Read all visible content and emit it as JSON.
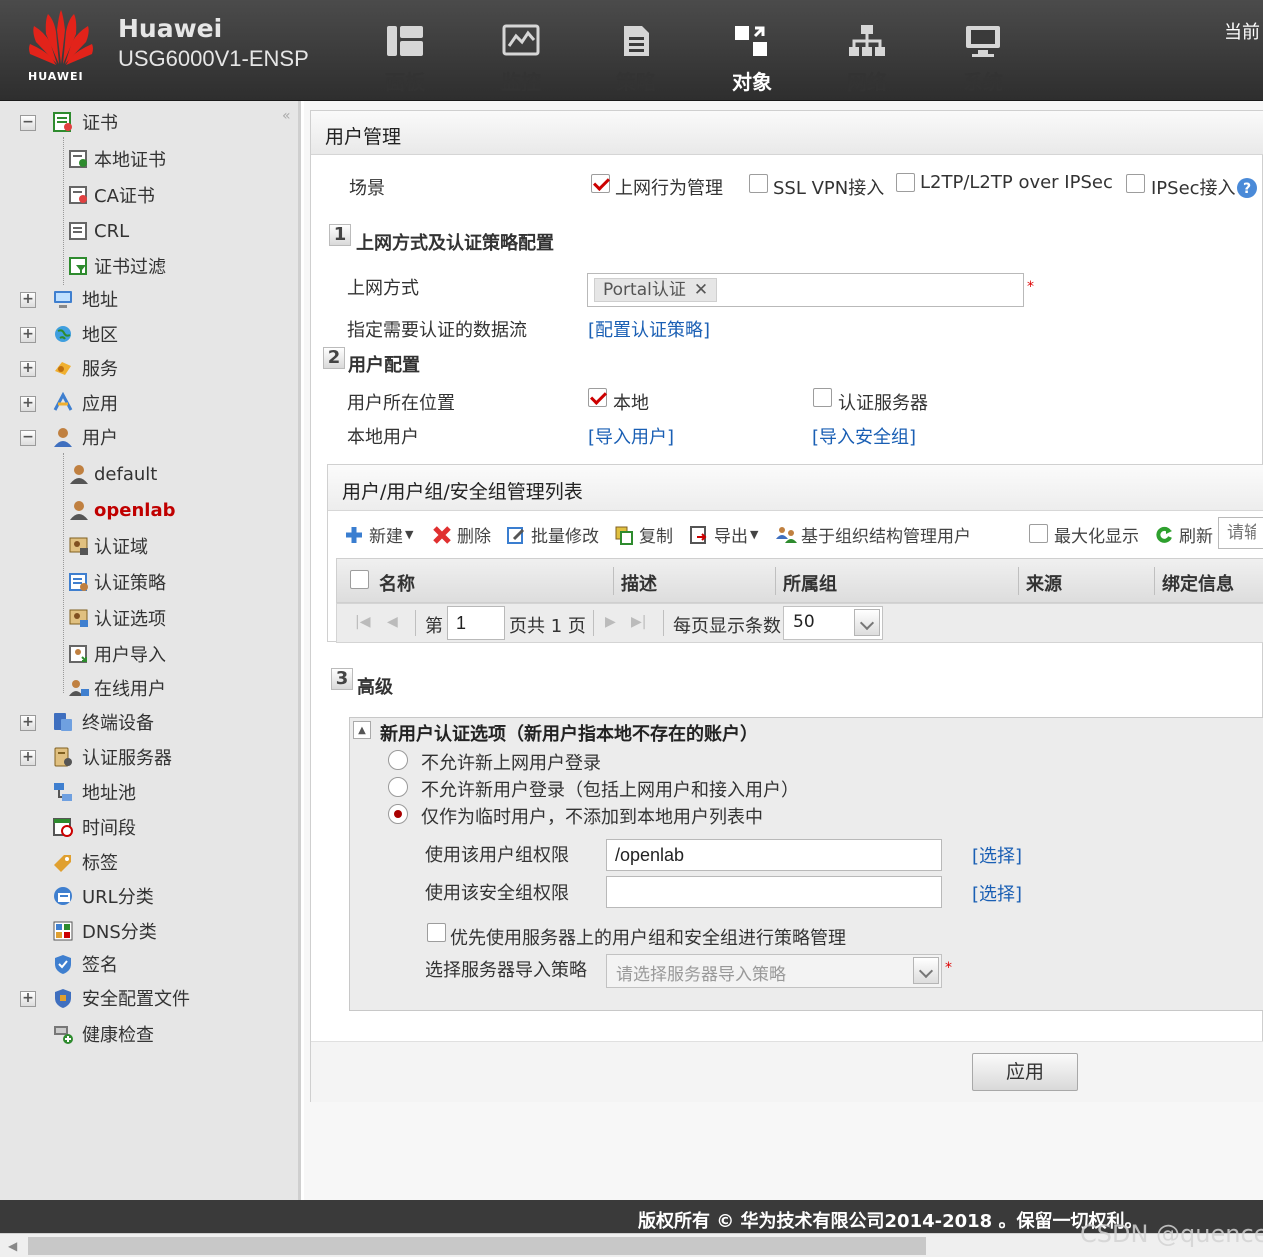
{
  "header": {
    "brand": "HUAWEI",
    "product_name": "Huawei",
    "product_model": "USG6000V1-ENSP",
    "current_user_label": "当前",
    "nav": [
      {
        "label": "面板",
        "icon": "dashboard-icon"
      },
      {
        "label": "监控",
        "icon": "monitor-icon"
      },
      {
        "label": "策略",
        "icon": "policy-icon"
      },
      {
        "label": "对象",
        "icon": "object-icon",
        "active": true
      },
      {
        "label": "网络",
        "icon": "network-icon"
      },
      {
        "label": "系统",
        "icon": "system-icon"
      }
    ]
  },
  "sidebar": {
    "items": [
      {
        "label": "证书",
        "expanded": true
      },
      {
        "label": "本地证书"
      },
      {
        "label": "CA证书"
      },
      {
        "label": "CRL"
      },
      {
        "label": "证书过滤"
      },
      {
        "label": "地址"
      },
      {
        "label": "地区"
      },
      {
        "label": "服务"
      },
      {
        "label": "应用"
      },
      {
        "label": "用户",
        "expanded": true
      },
      {
        "label": "default"
      },
      {
        "label": "openlab",
        "selected": true
      },
      {
        "label": "认证域"
      },
      {
        "label": "认证策略"
      },
      {
        "label": "认证选项"
      },
      {
        "label": "用户导入"
      },
      {
        "label": "在线用户"
      },
      {
        "label": "终端设备"
      },
      {
        "label": "认证服务器"
      },
      {
        "label": "地址池"
      },
      {
        "label": "时间段"
      },
      {
        "label": "标签"
      },
      {
        "label": "URL分类"
      },
      {
        "label": "DNS分类"
      },
      {
        "label": "签名"
      },
      {
        "label": "安全配置文件"
      },
      {
        "label": "健康检查"
      }
    ]
  },
  "main": {
    "title": "用户管理",
    "scene": {
      "label": "场景",
      "options": [
        {
          "label": "上网行为管理",
          "checked": true
        },
        {
          "label": "SSL VPN接入",
          "checked": false
        },
        {
          "label": "L2TP/L2TP over IPSec",
          "checked": false
        },
        {
          "label": "IPSec接入",
          "checked": false
        }
      ]
    },
    "section1": {
      "num": "1",
      "title": "上网方式及认证策略配置",
      "access_label": "上网方式",
      "access_tag": "Portal认证",
      "required_mark": "*",
      "flow_label": "指定需要认证的数据流",
      "flow_link": "[配置认证策略]"
    },
    "section2": {
      "num": "2",
      "title": "用户配置",
      "location_label": "用户所在位置",
      "location_local": {
        "label": "本地",
        "checked": true
      },
      "location_server": {
        "label": "认证服务器",
        "checked": false
      },
      "local_user_label": "本地用户",
      "import_user_link": "[导入用户]",
      "import_group_link": "[导入安全组]"
    },
    "grid": {
      "title": "用户/用户组/安全组管理列表",
      "toolbar": {
        "new": "新建",
        "delete": "删除",
        "batch_edit": "批量修改",
        "copy": "复制",
        "export": "导出",
        "org_manage": "基于组织结构管理用户",
        "maximize": "最大化显示",
        "refresh": "刷新",
        "search_placeholder": "请输"
      },
      "columns": [
        "名称",
        "描述",
        "所属组",
        "来源",
        "绑定信息"
      ],
      "pager": {
        "page_prefix": "第",
        "page_value": "1",
        "page_suffix": "页共 1 页",
        "per_page_label": "每页显示条数",
        "per_page_value": "50"
      }
    },
    "section3": {
      "num": "3",
      "title": "高级",
      "box_title": "新用户认证选项（新用户指本地不存在的账户）",
      "radios": [
        {
          "label": "不允许新上网用户登录",
          "checked": false
        },
        {
          "label": "不允许新用户登录（包括上网用户和接入用户）",
          "checked": false
        },
        {
          "label": "仅作为临时用户，不添加到本地用户列表中",
          "checked": true
        }
      ],
      "user_group_label": "使用该用户组权限",
      "user_group_value": "/openlab",
      "security_group_label": "使用该安全组权限",
      "security_group_value": "",
      "select_link": "[选择]",
      "prefer_server_label": "优先使用服务器上的用户组和安全组进行策略管理",
      "import_policy_label": "选择服务器导入策略",
      "import_policy_placeholder": "请选择服务器导入策略",
      "required_mark": "*"
    },
    "apply_button": "应用"
  },
  "footer": {
    "copyright": "版权所有 © 华为技术有限公司2014-2018 。保留一切权利。",
    "watermark": "CSDN @quencep"
  }
}
